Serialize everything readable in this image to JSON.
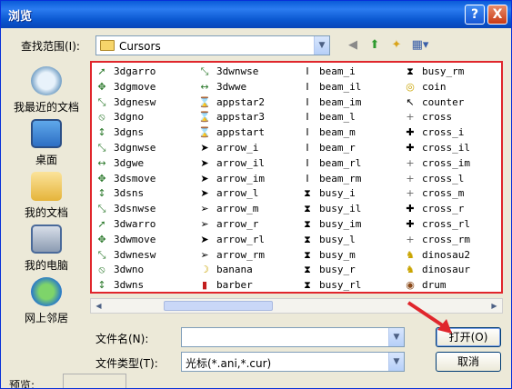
{
  "window": {
    "title": "浏览",
    "help": "?",
    "close": "X"
  },
  "lookin": {
    "label": "查找范围(I):",
    "value": "Cursors"
  },
  "places": [
    {
      "label": "我最近的文档"
    },
    {
      "label": "桌面"
    },
    {
      "label": "我的文档"
    },
    {
      "label": "我的电脑"
    },
    {
      "label": "网上邻居"
    }
  ],
  "files": [
    {
      "name": "3dgarro",
      "icon": "arrow"
    },
    {
      "name": "3dgmove",
      "icon": "move"
    },
    {
      "name": "3dgnesw",
      "icon": "diag"
    },
    {
      "name": "3dgno",
      "icon": "no"
    },
    {
      "name": "3dgns",
      "icon": "vert"
    },
    {
      "name": "3dgnwse",
      "icon": "diag"
    },
    {
      "name": "3dgwe",
      "icon": "horiz"
    },
    {
      "name": "3dsmove",
      "icon": "move"
    },
    {
      "name": "3dsns",
      "icon": "vert"
    },
    {
      "name": "3dsnwse",
      "icon": "diag"
    },
    {
      "name": "3dwarro",
      "icon": "arrow"
    },
    {
      "name": "3dwmove",
      "icon": "move"
    },
    {
      "name": "3dwnesw",
      "icon": "diag"
    },
    {
      "name": "3dwno",
      "icon": "no"
    },
    {
      "name": "3dwns",
      "icon": "vert"
    },
    {
      "name": "3dwnwse",
      "icon": "diag"
    },
    {
      "name": "3dwwe",
      "icon": "horiz"
    },
    {
      "name": "appstar2",
      "icon": "appstart"
    },
    {
      "name": "appstar3",
      "icon": "appstart"
    },
    {
      "name": "appstart",
      "icon": "appstart"
    },
    {
      "name": "arrow_i",
      "icon": "arrowblack"
    },
    {
      "name": "arrow_il",
      "icon": "arrowblack"
    },
    {
      "name": "arrow_im",
      "icon": "arrowblack"
    },
    {
      "name": "arrow_l",
      "icon": "arrowblack"
    },
    {
      "name": "arrow_m",
      "icon": "arrowwhite"
    },
    {
      "name": "arrow_r",
      "icon": "arrowwhite"
    },
    {
      "name": "arrow_rl",
      "icon": "arrowblack"
    },
    {
      "name": "arrow_rm",
      "icon": "arrowwhite"
    },
    {
      "name": "banana",
      "icon": "banana"
    },
    {
      "name": "barber",
      "icon": "barber"
    },
    {
      "name": "beam_i",
      "icon": "beam"
    },
    {
      "name": "beam_il",
      "icon": "beam"
    },
    {
      "name": "beam_im",
      "icon": "beam"
    },
    {
      "name": "beam_l",
      "icon": "beam"
    },
    {
      "name": "beam_m",
      "icon": "beam"
    },
    {
      "name": "beam_r",
      "icon": "beam"
    },
    {
      "name": "beam_rl",
      "icon": "beam"
    },
    {
      "name": "beam_rm",
      "icon": "beam"
    },
    {
      "name": "busy_i",
      "icon": "hourglass"
    },
    {
      "name": "busy_il",
      "icon": "hourglass"
    },
    {
      "name": "busy_im",
      "icon": "hourglass"
    },
    {
      "name": "busy_l",
      "icon": "hourglass"
    },
    {
      "name": "busy_m",
      "icon": "hourglass"
    },
    {
      "name": "busy_r",
      "icon": "hourglass"
    },
    {
      "name": "busy_rl",
      "icon": "hourglass"
    },
    {
      "name": "busy_rm",
      "icon": "hourglass"
    },
    {
      "name": "coin",
      "icon": "coin"
    },
    {
      "name": "counter",
      "icon": "counter"
    },
    {
      "name": "cross",
      "icon": "cross"
    },
    {
      "name": "cross_i",
      "icon": "crossbold"
    },
    {
      "name": "cross_il",
      "icon": "crossbold"
    },
    {
      "name": "cross_im",
      "icon": "cross"
    },
    {
      "name": "cross_l",
      "icon": "cross"
    },
    {
      "name": "cross_m",
      "icon": "cross"
    },
    {
      "name": "cross_r",
      "icon": "crossbold"
    },
    {
      "name": "cross_rl",
      "icon": "crossbold"
    },
    {
      "name": "cross_rm",
      "icon": "cross"
    },
    {
      "name": "dinosau2",
      "icon": "dino"
    },
    {
      "name": "dinosaur",
      "icon": "dino"
    },
    {
      "name": "drum",
      "icon": "drum"
    }
  ],
  "filename": {
    "label": "文件名(N):",
    "value": ""
  },
  "filetype": {
    "label": "文件类型(T):",
    "value": "光标(*.ani,*.cur)"
  },
  "buttons": {
    "open": "打开(O)",
    "cancel": "取消"
  },
  "preview": {
    "label": "预览:"
  }
}
